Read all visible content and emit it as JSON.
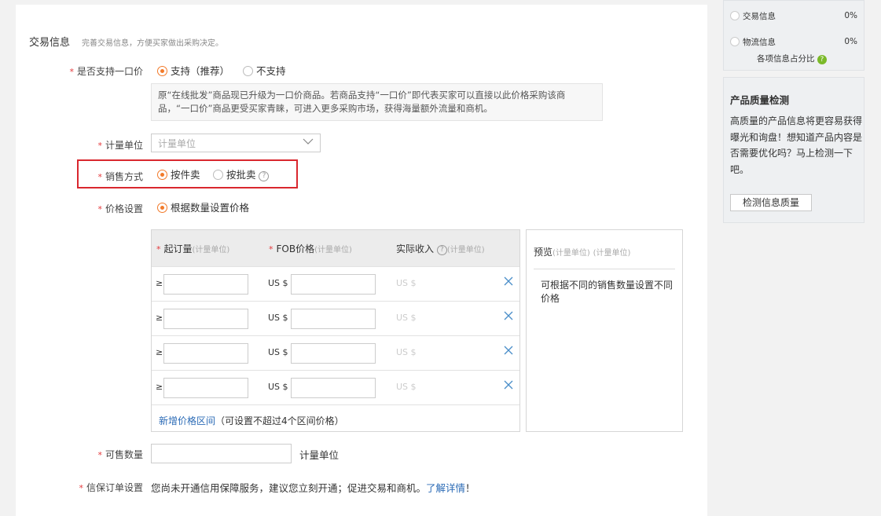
{
  "trade_info": {
    "title": "交易信息",
    "desc": "完善交易信息，方便买家做出采购决定。",
    "fixed_price": {
      "label": "是否支持一口价",
      "option_yes": "支持（推荐）",
      "option_no": "不支持",
      "tip": "原“在线批发”商品现已升级为一口价商品。若商品支持“一口价”即代表买家可以直接以此价格采购该商品，“一口价”商品更受买家青睐，可进入更多采购市场，获得海量额外流量和商机。"
    },
    "unit": {
      "label": "计量单位",
      "placeholder": "计量单位"
    },
    "sale_method": {
      "label": "销售方式",
      "option_piece": "按件卖",
      "option_batch": "按批卖"
    },
    "price_setting": {
      "label": "价格设置",
      "option": "根据数量设置价格"
    },
    "table": {
      "col_moq": "起订量",
      "col_moq_unit": "(计量单位)",
      "col_fob": "FOB价格",
      "col_fob_unit": "(计量单位)",
      "col_actual": "实际收入",
      "col_actual_unit": "(计量单位)",
      "ge": "≥",
      "usd": "US $",
      "usd_gray": "US $",
      "add_link": "新增价格区间",
      "add_note": "（可设置不超过4个区间价格）"
    },
    "preview": {
      "title": "预览",
      "unit1": "(计量单位)",
      "unit2": "(计量单位)",
      "text": "可根据不同的销售数量设置不同价格"
    },
    "quantity": {
      "label": "可售数量",
      "unit": "计量单位"
    },
    "escrow": {
      "label": "信保订单设置",
      "text": "您尚未开通信用保障服务，建议您立刻开通；促进交易和商机。",
      "link": "了解详情",
      "suffix": "！"
    }
  },
  "sidebar": {
    "items": [
      {
        "label": "交易信息",
        "pct": "0%"
      },
      {
        "label": "物流信息",
        "pct": "0%"
      }
    ],
    "ratio_label": "各项信息占分比",
    "quality": {
      "title": "产品质量检测",
      "text": "高质量的产品信息将更容易获得曝光和询盘！想知道产品内容是否需要优化吗？马上检测一下吧。",
      "button": "检测信息质量"
    }
  },
  "colors": {
    "accent": "#f27a2a",
    "required": "#e4393c",
    "link": "#2b6bb6",
    "highlight": "#d9272e"
  }
}
